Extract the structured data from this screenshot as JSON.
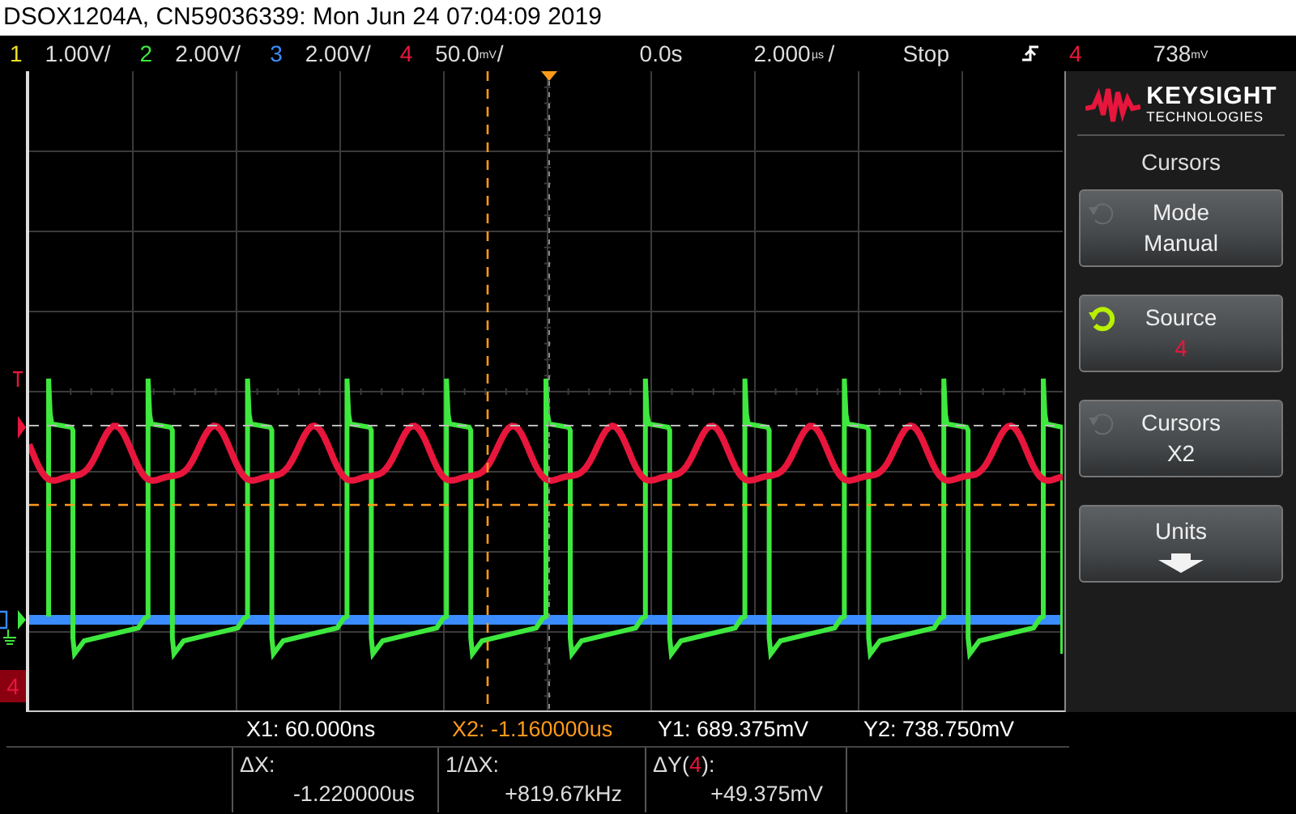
{
  "title": "DSOX1204A, CN59036339: Mon Jun 24 07:04:09 2019",
  "channels": [
    {
      "number": "1",
      "color": "#f0e020",
      "scale": "1.00V/"
    },
    {
      "number": "2",
      "color": "#3ee83e",
      "scale": "2.00V/"
    },
    {
      "number": "3",
      "color": "#3a8cff",
      "scale": "2.00V/"
    },
    {
      "number": "4",
      "color": "#e8163c",
      "scale": "50.0",
      "unit": "mV",
      "tail": "/"
    }
  ],
  "timebase": {
    "delay": "0.0s",
    "scale": "2.000",
    "unit": "µs",
    "tail": "/"
  },
  "run_state": "Stop",
  "trigger": {
    "source": {
      "text": "4",
      "color": "#e8163c"
    },
    "level": "738",
    "unit": "mV"
  },
  "logo": {
    "name": "KEYSIGHT",
    "sub": "TECHNOLOGIES"
  },
  "menu": {
    "title": "Cursors",
    "softkeys": [
      {
        "kind": "value",
        "label": "Mode",
        "value": "Manual",
        "knob_active": false
      },
      {
        "kind": "value",
        "label": "Source",
        "value": "4",
        "color": "#e8163c",
        "knob_active": true
      },
      {
        "kind": "value",
        "label": "Cursors",
        "value": "X2",
        "knob_active": false
      },
      {
        "kind": "arrow",
        "label": "Units"
      }
    ]
  },
  "ground_marker": {
    "label": "4"
  },
  "cursor_readout": [
    {
      "label": "X1:",
      "value": "60.000ns",
      "active": false
    },
    {
      "label": "X2:",
      "value": "-1.160000us",
      "active": true
    },
    {
      "label": "Y1:",
      "value": "689.375mV",
      "active": false
    },
    {
      "label": "Y2:",
      "value": "738.750mV",
      "active": false
    }
  ],
  "delta_readout": [
    {
      "label": "ΔX:",
      "value": "-1.220000us"
    },
    {
      "label": "1/ΔX:",
      "value": "+819.67kHz"
    },
    {
      "label": "ΔY(",
      "channel": {
        "text": "4",
        "color": "#e8163c"
      },
      "label_end": "):",
      "value": "+49.375mV"
    }
  ]
}
